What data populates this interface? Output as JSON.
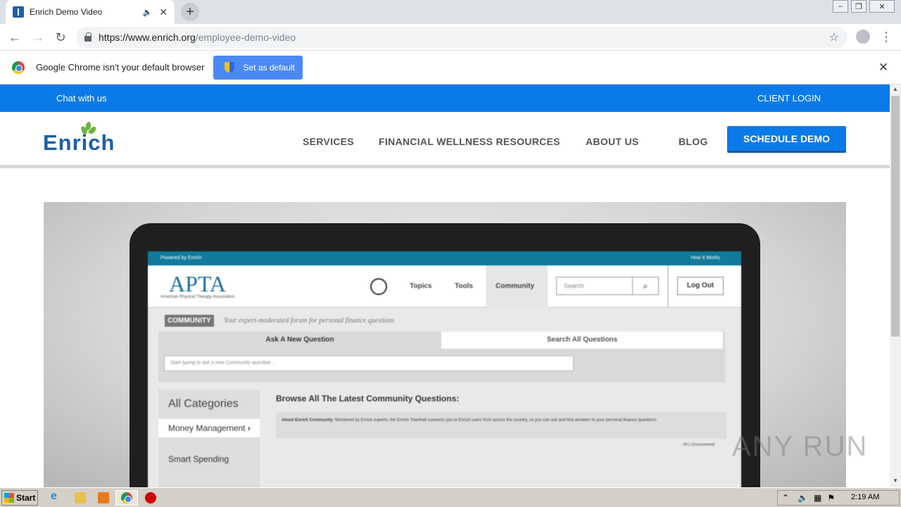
{
  "browser": {
    "tab_title": "Enrich Demo Video",
    "url_host": "https://www.enrich.org",
    "url_path": "/employee-demo-video",
    "infobar_text": "Google Chrome isn't your default browser",
    "set_default_label": "Set as default"
  },
  "site": {
    "chat_label": "Chat with us",
    "client_login_label": "CLIENT LOGIN",
    "logo_text": "Enrich",
    "nav": [
      "SERVICES",
      "FINANCIAL WELLNESS RESOURCES",
      "ABOUT US",
      "BLOG"
    ],
    "cta_label": "SCHEDULE DEMO"
  },
  "video_screen": {
    "top_left": "Powered by Enrich",
    "top_right": "How It Works",
    "logo": "APTA",
    "logo_sub": "American Physical Therapy Association.",
    "nav": [
      "Topics",
      "Tools",
      "Community"
    ],
    "search_placeholder": "Search",
    "logout_label": "Log Out",
    "community_badge": "COMMUNITY",
    "community_tagline": "Your expert-moderated forum for personal finance questions",
    "tab_ask": "Ask A New Question",
    "tab_search": "Search All Questions",
    "question_placeholder": "Start typing to ask a new Community question...",
    "all_categories": "All Categories",
    "category_1": "Money Management",
    "category_2": "Smart Spending",
    "browse_heading": "Browse All The Latest Community Questions:",
    "about_label": "About Enrich Community:",
    "about_text": "Monitored by Enrich experts, the Enrich Townhall connects you to Enrich users from across the country, so you can ask and find answers to your personal finance questions.",
    "filters": "All | Unanswered"
  },
  "watermark": "ANY RUN",
  "taskbar": {
    "start_label": "Start",
    "clock": "2:19 AM"
  }
}
